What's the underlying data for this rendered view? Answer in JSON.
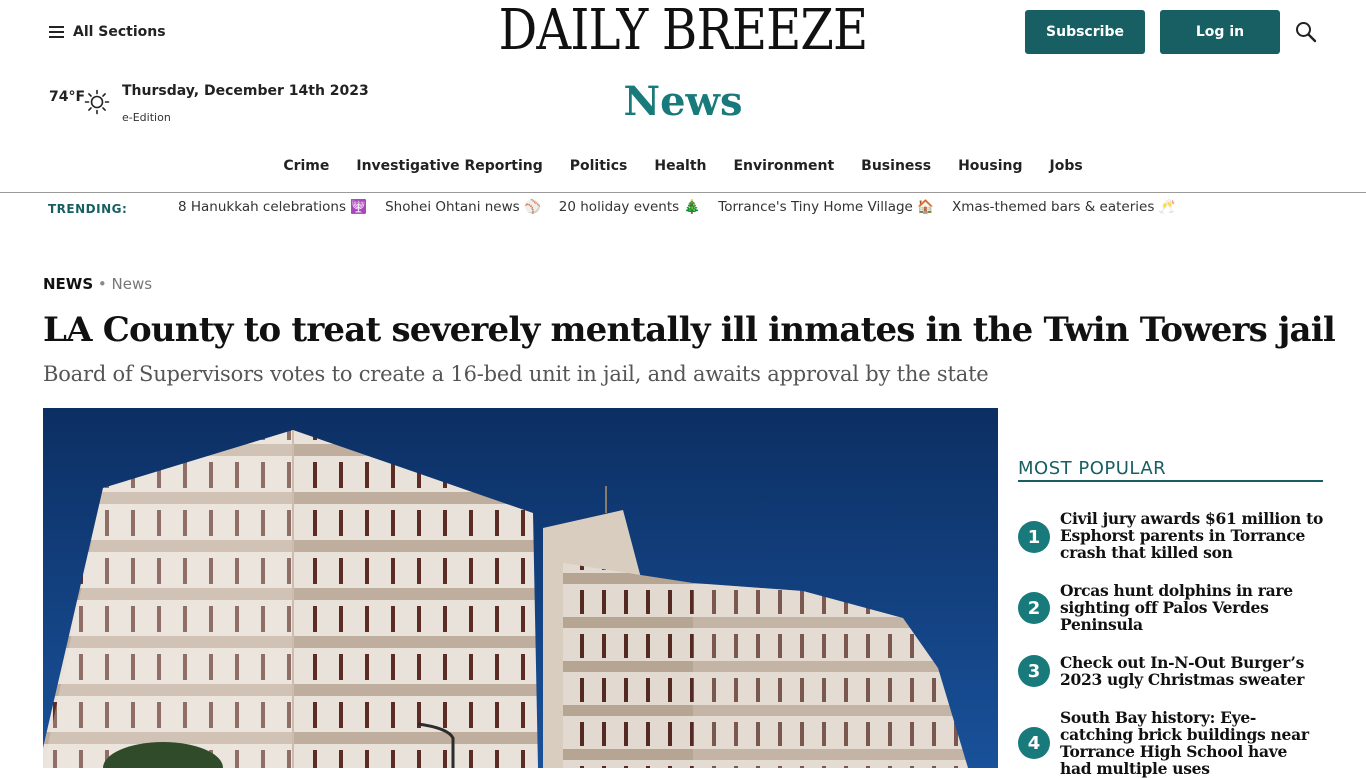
{
  "header": {
    "all_sections_label": "All Sections",
    "logo_text": "DAILY BREEZE",
    "subscribe_label": "Subscribe",
    "login_label": "Log in",
    "search_icon": "search-icon",
    "weather": {
      "temp": "74°F",
      "icon": "sun-icon"
    },
    "date": "Thursday, December 14th 2023",
    "e_edition": "e-Edition",
    "section_title": "News"
  },
  "nav": {
    "items": [
      {
        "label": "Crime"
      },
      {
        "label": "Investigative Reporting"
      },
      {
        "label": "Politics"
      },
      {
        "label": "Health"
      },
      {
        "label": "Environment"
      },
      {
        "label": "Business"
      },
      {
        "label": "Housing"
      },
      {
        "label": "Jobs"
      }
    ]
  },
  "trending": {
    "label": "TRENDING:",
    "items": [
      {
        "label": "8 Hanukkah celebrations 🕎"
      },
      {
        "label": "Shohei Ohtani news ⚾"
      },
      {
        "label": "20 holiday events 🎄"
      },
      {
        "label": "Torrance's Tiny Home Village 🏠"
      },
      {
        "label": "Xmas-themed bars & eateries 🥂"
      }
    ]
  },
  "article": {
    "breadcrumb_primary": "NEWS",
    "breadcrumb_sep": " • ",
    "breadcrumb_secondary": "News",
    "headline": "LA County to treat severely mentally ill inmates in the Twin Towers jail",
    "subhead": "Board of Supervisors votes to create a 16-bed unit in jail, and awaits approval by the state"
  },
  "most_popular": {
    "title": "MOST POPULAR",
    "items": [
      {
        "num": "1",
        "title": "Civil jury awards $61 million to Esphorst parents in Torrance crash that killed son"
      },
      {
        "num": "2",
        "title": "Orcas hunt dolphins in rare sighting off Palos Verdes Peninsula"
      },
      {
        "num": "3",
        "title": "Check out In-N-Out Burger’s 2023 ugly Christmas sweater"
      },
      {
        "num": "4",
        "title": "South Bay history: Eye-catching brick buildings near Torrance High School have had multiple uses"
      }
    ]
  },
  "colors": {
    "brand_teal": "#185f63",
    "section_teal": "#187a7a"
  }
}
